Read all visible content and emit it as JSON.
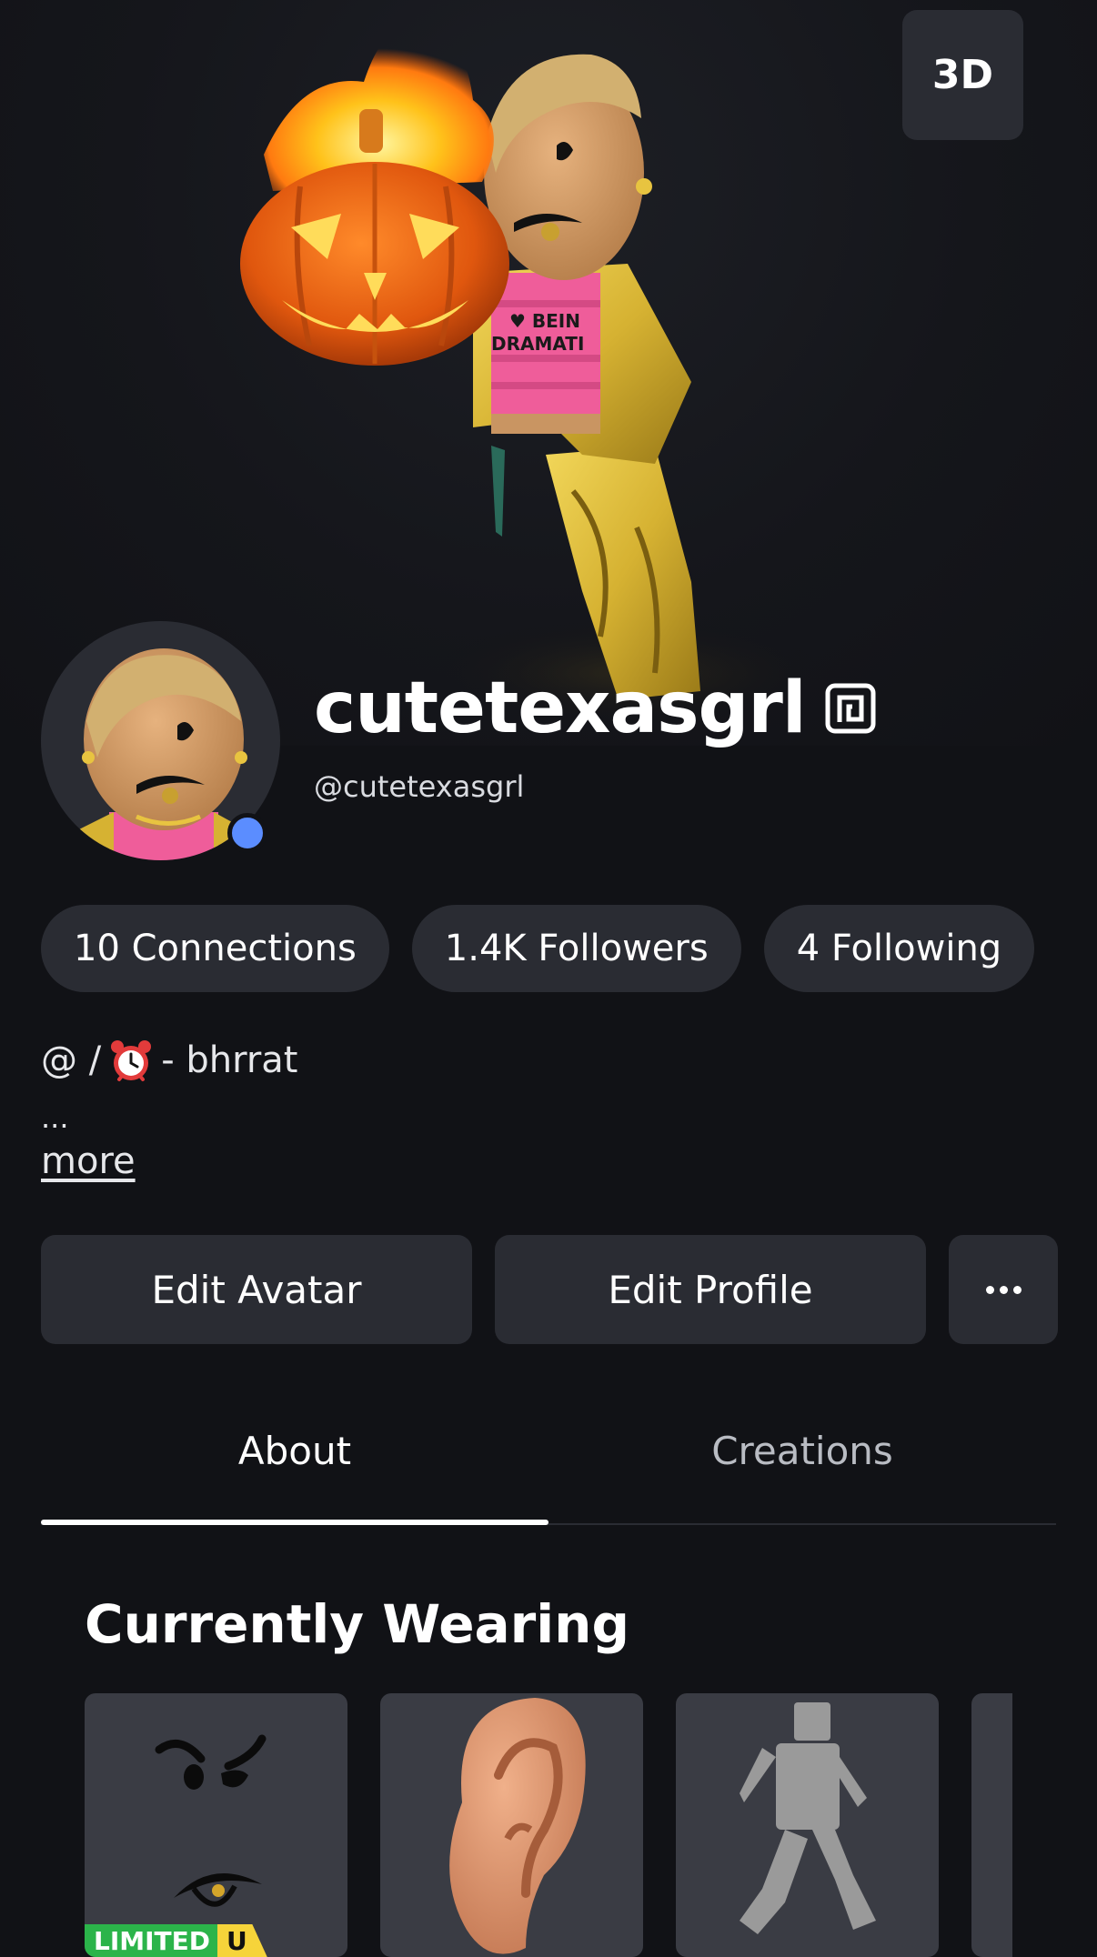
{
  "hero": {
    "view_toggle_label": "3D"
  },
  "profile": {
    "display_name": "cutetexasgrl",
    "username": "@cutetexasgrl",
    "presence_color": "#5b8dff"
  },
  "stats": [
    {
      "label": "10 Connections"
    },
    {
      "label": "1.4K Followers"
    },
    {
      "label": "4 Following"
    }
  ],
  "bio": {
    "prefix": "@ /",
    "emoji_icon": "alarm-clock-icon",
    "suffix": "- bhrrat",
    "ellipsis": "...",
    "more_label": "more"
  },
  "actions": {
    "edit_avatar_label": "Edit Avatar",
    "edit_profile_label": "Edit Profile",
    "more_icon": "ellipsis-icon"
  },
  "tabs": [
    {
      "label": "About",
      "active": true
    },
    {
      "label": "Creations",
      "active": false
    }
  ],
  "currently_wearing": {
    "title": "Currently Wearing",
    "items": [
      {
        "name": "face-item",
        "badge": "LIMITED",
        "badge_suffix": "U"
      },
      {
        "name": "ear-item"
      },
      {
        "name": "animation-item"
      },
      {
        "name": "partial-item"
      }
    ]
  },
  "colors": {
    "background": "#111216",
    "surface": "#2a2c33",
    "presence": "#5b8dff",
    "limited_green": "#2bb44a",
    "limited_yellow": "#f6d43a"
  }
}
